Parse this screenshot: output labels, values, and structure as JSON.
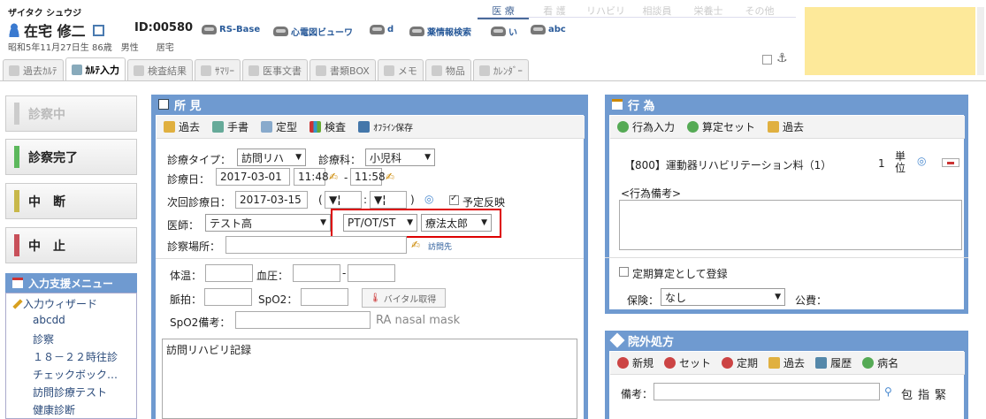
{
  "patient": {
    "kana": "ザイタク シュウジ",
    "name": "在宅 修二",
    "id": "ID:00580",
    "birth": "昭和5年11月27日生 86歳",
    "sex": "男性",
    "home": "居宅"
  },
  "ext_links": [
    "RS-Base",
    "心電図ビューワ",
    "d",
    "薬情報検索",
    "い",
    "abc"
  ],
  "roles": [
    "医 療",
    "看 護",
    "リハビリ",
    "相談員",
    "栄養士",
    "その他"
  ],
  "tabs": [
    "過去ｶﾙﾃ",
    "ｶﾙﾃ入力",
    "検査結果",
    "ｻﾏﾘｰ",
    "医事文書",
    "書類BOX",
    "メモ",
    "物品",
    "ｶﾚﾝﾀﾞｰ"
  ],
  "left_buttons": [
    "診察中",
    "診察完了",
    "中　断",
    "中　止"
  ],
  "left_colors": [
    "#cccccc",
    "#5cb85c",
    "#c8b84a",
    "#c8505a"
  ],
  "menu": {
    "title": "入力支援メニュー",
    "root": "入力ウィザード",
    "items": [
      "abcdd",
      "診察",
      "１８－２２時往診",
      "チェックボック…",
      "訪問診療テスト",
      "健康診断"
    ]
  },
  "shoken": {
    "title": "所 見",
    "toolbar": [
      "過去",
      "手書",
      "定型",
      "検査",
      "ｵﾌﾗｲﾝ保存"
    ],
    "type_label": "診療タイプ：",
    "type_value": "訪問リハ",
    "dept_label": "診療科：",
    "dept_value": "小児科",
    "date_label": "診療日：",
    "date_value": "2017-03-01",
    "time_from": "11:48",
    "dash": "-",
    "time_to": "11:58",
    "next_label": "次回診療日：",
    "next_value": "2017-03-15",
    "next_h": "▼¦",
    "next_m": "▼¦",
    "paren_open": "(",
    "colon": ":",
    "paren_close": ")",
    "yotei": "予定反映",
    "doctor_label": "医師：",
    "doctor_value": "テスト高",
    "role_value": "PT/OT/ST",
    "therapist_value": "療法太郎",
    "place_label": "診察場所：",
    "houmon": "訪問先",
    "temp_label": "体温：",
    "bp_label": "血圧：",
    "bp_dash": "-",
    "pulse_label": "脈拍：",
    "spo2_label": "SpO2：",
    "vital_btn": "バイタル取得",
    "spo2note_label": "SpO2備考：",
    "spo2note_hint": "RA nasal mask",
    "memo": "訪問リハビリ記録"
  },
  "koi": {
    "title": "行 為",
    "toolbar": [
      "行為入力",
      "算定セット",
      "過去"
    ],
    "item": "【800】運動器リハビリテーション料（1）",
    "qty": "1",
    "unit": "単位",
    "note_label": "<行為備考>",
    "teiki": "定期算定として登録",
    "hoken_label": "保険：",
    "hoken_value": "なし",
    "kohi_label": "公費："
  },
  "ingai": {
    "title": "院外処方",
    "toolbar": [
      "新規",
      "セット",
      "定期",
      "過去",
      "履歴",
      "病名"
    ],
    "note_label": "備考：",
    "extra": [
      "包",
      "指",
      "緊"
    ]
  }
}
